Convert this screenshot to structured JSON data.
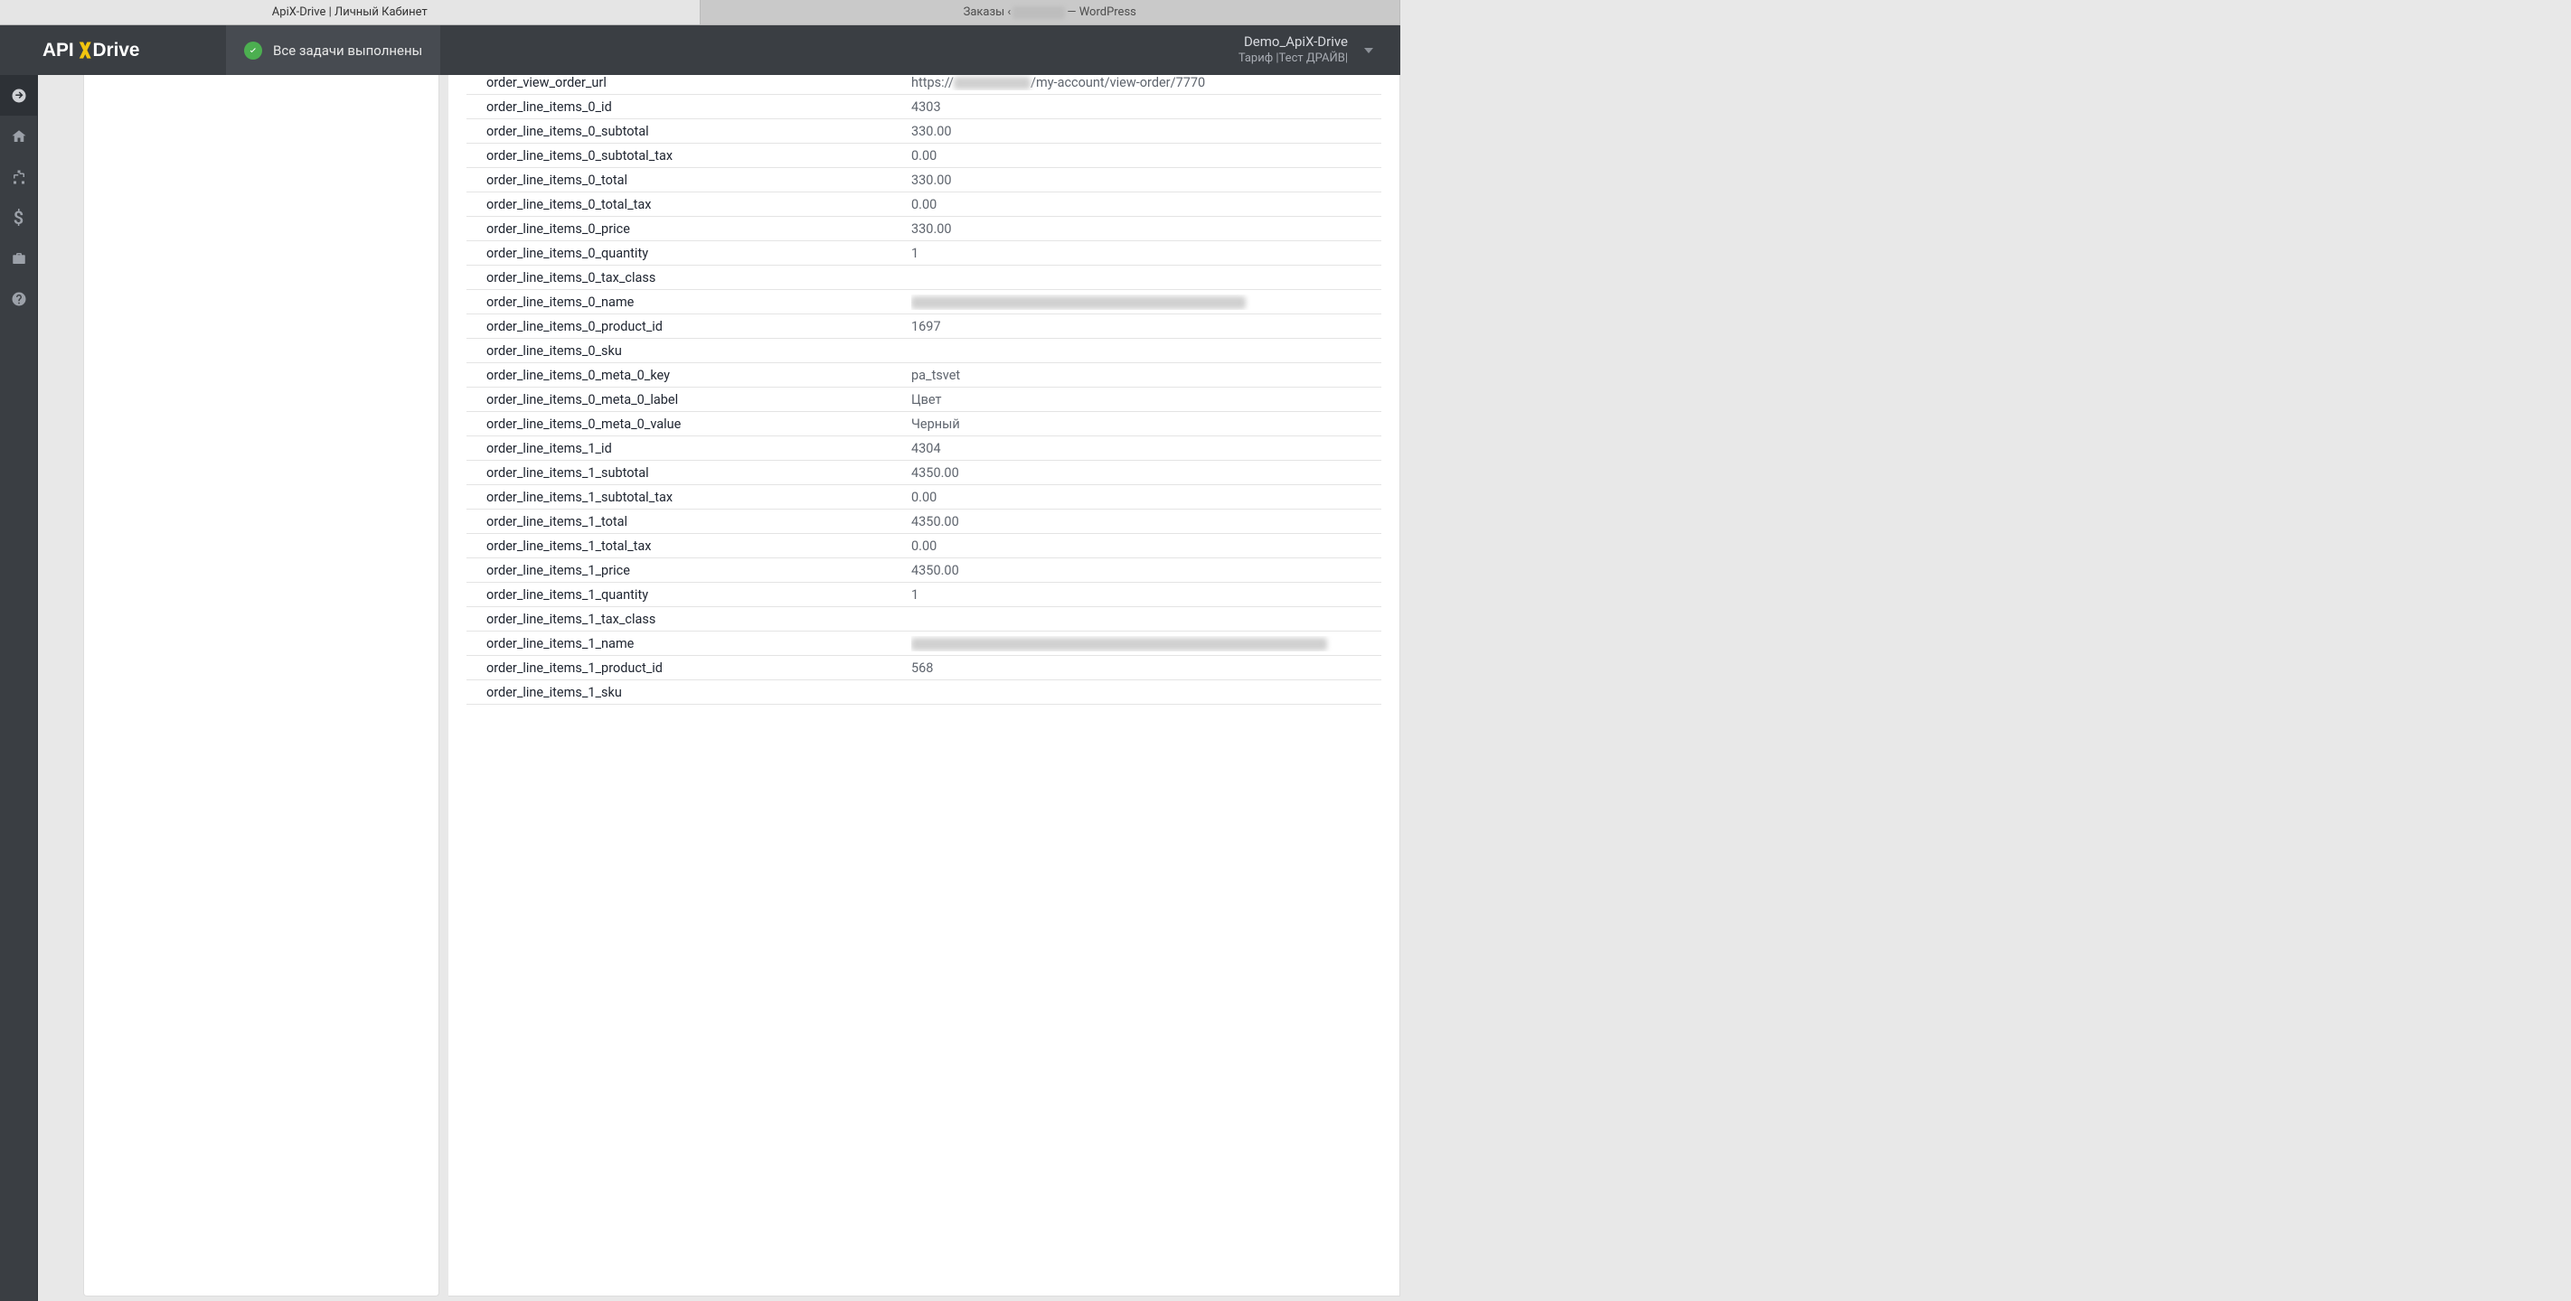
{
  "tabs": {
    "active": "ApiX-Drive | Личный Кабинет",
    "inactive_prefix": "Заказы ‹ ",
    "inactive_suffix": " — WordPress"
  },
  "header": {
    "status_text": "Все задачи выполнены",
    "account_name": "Demo_ApiX-Drive",
    "account_tariff": "Тариф |Тест ДРАЙВ|"
  },
  "fields": [
    {
      "key": "order_view_order_url",
      "value": "https://                   /my-account/view-order/7770",
      "redact_segment": true
    },
    {
      "key": "order_line_items_0_id",
      "value": "4303"
    },
    {
      "key": "order_line_items_0_subtotal",
      "value": "330.00"
    },
    {
      "key": "order_line_items_0_subtotal_tax",
      "value": "0.00"
    },
    {
      "key": "order_line_items_0_total",
      "value": "330.00"
    },
    {
      "key": "order_line_items_0_total_tax",
      "value": "0.00"
    },
    {
      "key": "order_line_items_0_price",
      "value": "330.00"
    },
    {
      "key": "order_line_items_0_quantity",
      "value": "1"
    },
    {
      "key": "order_line_items_0_tax_class",
      "value": ""
    },
    {
      "key": "order_line_items_0_name",
      "value": "",
      "redact_full": true,
      "redact_width": 370
    },
    {
      "key": "order_line_items_0_product_id",
      "value": "1697"
    },
    {
      "key": "order_line_items_0_sku",
      "value": ""
    },
    {
      "key": "order_line_items_0_meta_0_key",
      "value": "pa_tsvet"
    },
    {
      "key": "order_line_items_0_meta_0_label",
      "value": "Цвет"
    },
    {
      "key": "order_line_items_0_meta_0_value",
      "value": "Черный"
    },
    {
      "key": "order_line_items_1_id",
      "value": "4304"
    },
    {
      "key": "order_line_items_1_subtotal",
      "value": "4350.00"
    },
    {
      "key": "order_line_items_1_subtotal_tax",
      "value": "0.00"
    },
    {
      "key": "order_line_items_1_total",
      "value": "4350.00"
    },
    {
      "key": "order_line_items_1_total_tax",
      "value": "0.00"
    },
    {
      "key": "order_line_items_1_price",
      "value": "4350.00"
    },
    {
      "key": "order_line_items_1_quantity",
      "value": "1"
    },
    {
      "key": "order_line_items_1_tax_class",
      "value": ""
    },
    {
      "key": "order_line_items_1_name",
      "value": "",
      "redact_full": true,
      "redact_width": 460
    },
    {
      "key": "order_line_items_1_product_id",
      "value": "568"
    },
    {
      "key": "order_line_items_1_sku",
      "value": ""
    }
  ]
}
